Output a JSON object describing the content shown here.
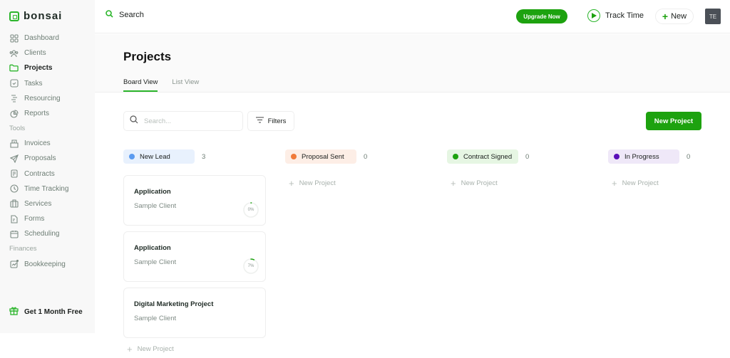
{
  "app": {
    "brand": "bonsai"
  },
  "sidebar": {
    "items": [
      {
        "label": "Dashboard",
        "icon": "dashboard-icon",
        "active": false
      },
      {
        "label": "Clients",
        "icon": "clients-icon",
        "active": false
      },
      {
        "label": "Projects",
        "icon": "folder-icon",
        "active": true
      },
      {
        "label": "Tasks",
        "icon": "tasks-icon",
        "active": false
      },
      {
        "label": "Resourcing",
        "icon": "resourcing-icon",
        "active": false
      },
      {
        "label": "Reports",
        "icon": "reports-icon",
        "active": false
      }
    ],
    "tools_label": "Tools",
    "tools": [
      {
        "label": "Invoices",
        "icon": "invoice-icon"
      },
      {
        "label": "Proposals",
        "icon": "send-icon"
      },
      {
        "label": "Contracts",
        "icon": "contract-icon"
      },
      {
        "label": "Time Tracking",
        "icon": "clock-icon"
      },
      {
        "label": "Services",
        "icon": "briefcase-icon"
      },
      {
        "label": "Forms",
        "icon": "form-icon"
      },
      {
        "label": "Scheduling",
        "icon": "calendar-icon"
      }
    ],
    "finances_label": "Finances",
    "finances": [
      {
        "label": "Bookkeeping",
        "icon": "chart-icon"
      }
    ],
    "promo_label": "Get 1 Month Free"
  },
  "topbar": {
    "search_label": "Search",
    "upgrade_label": "Upgrade Now",
    "track_time_label": "Track Time",
    "new_label": "New",
    "avatar_initials": "TE"
  },
  "page": {
    "title": "Projects",
    "tabs": [
      {
        "label": "Board View",
        "active": true
      },
      {
        "label": "List View",
        "active": false
      }
    ]
  },
  "toolbar": {
    "search_placeholder": "Search...",
    "filters_label": "Filters",
    "new_project_label": "New Project"
  },
  "columns": [
    {
      "label": "New Lead",
      "count": "3",
      "dot_color": "#5b9bf0",
      "bg_color": "#e8f1fd",
      "cards": [
        {
          "title": "Application",
          "client": "Sample Client",
          "progress": 0,
          "progress_label": "0%"
        },
        {
          "title": "Application",
          "client": "Sample Client",
          "progress": 7,
          "progress_label": "7%"
        },
        {
          "title": "Digital Marketing Project",
          "client": "Sample Client"
        }
      ],
      "add_label": "New Project"
    },
    {
      "label": "Proposal Sent",
      "count": "0",
      "dot_color": "#f07a3a",
      "bg_color": "#fdeee6",
      "cards": [],
      "add_label": "New Project"
    },
    {
      "label": "Contract Signed",
      "count": "0",
      "dot_color": "#1da20f",
      "bg_color": "#e6f6e3",
      "cards": [],
      "add_label": "New Project"
    },
    {
      "label": "In Progress",
      "count": "0",
      "dot_color": "#5a10b8",
      "bg_color": "#efe8f8",
      "cards": [],
      "add_label": "New Project"
    }
  ],
  "colors": {
    "accent": "#1da20f",
    "brand_green": "#2bb52b"
  }
}
